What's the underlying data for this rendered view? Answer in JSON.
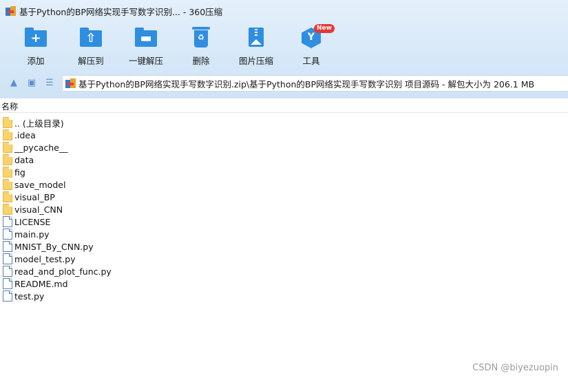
{
  "window": {
    "title": "基于Python的BP网络实现手写数字识别... - 360压缩",
    "app_icon": "360zip-logo-icon"
  },
  "toolbar": [
    {
      "label": "添加",
      "icon": "add-folder-icon",
      "glyph": "+"
    },
    {
      "label": "解压到",
      "icon": "extract-to-folder-icon",
      "glyph": "⇧"
    },
    {
      "label": "一键解压",
      "icon": "one-click-extract-icon",
      "glyph": "▬"
    },
    {
      "label": "删除",
      "icon": "recycle-bin-icon",
      "glyph": "♻"
    },
    {
      "label": "图片压缩",
      "icon": "image-compress-icon",
      "glyph": ""
    },
    {
      "label": "工具",
      "icon": "tools-icon",
      "glyph": "Y",
      "badge": "New"
    }
  ],
  "nav": {
    "up_icon": "up-arrow-icon",
    "view_icon": "thumbnail-view-icon",
    "list_icon": "list-view-icon"
  },
  "address": {
    "path": "基于Python的BP网络实现手写数字识别.zip\\基于Python的BP网络实现手写数字识别 项目源码 - 解包大小为 206.1 MB"
  },
  "list": {
    "header": "名称",
    "items": [
      {
        "name": ".. (上级目录)",
        "type": "folder"
      },
      {
        "name": ".idea",
        "type": "folder"
      },
      {
        "name": "__pycache__",
        "type": "folder"
      },
      {
        "name": "data",
        "type": "folder"
      },
      {
        "name": "fig",
        "type": "folder"
      },
      {
        "name": "save_model",
        "type": "folder"
      },
      {
        "name": "visual_BP",
        "type": "folder"
      },
      {
        "name": "visual_CNN",
        "type": "folder"
      },
      {
        "name": "LICENSE",
        "type": "file"
      },
      {
        "name": "main.py",
        "type": "file"
      },
      {
        "name": "MNIST_By_CNN.py",
        "type": "file"
      },
      {
        "name": "model_test.py",
        "type": "file"
      },
      {
        "name": "read_and_plot_func.py",
        "type": "file"
      },
      {
        "name": "README.md",
        "type": "file"
      },
      {
        "name": "test.py",
        "type": "file"
      }
    ]
  },
  "watermark": "CSDN @biyezuopin",
  "colors": {
    "accent": "#2f8ee0",
    "folder": "#f9d46c",
    "badge": "#e53935"
  }
}
